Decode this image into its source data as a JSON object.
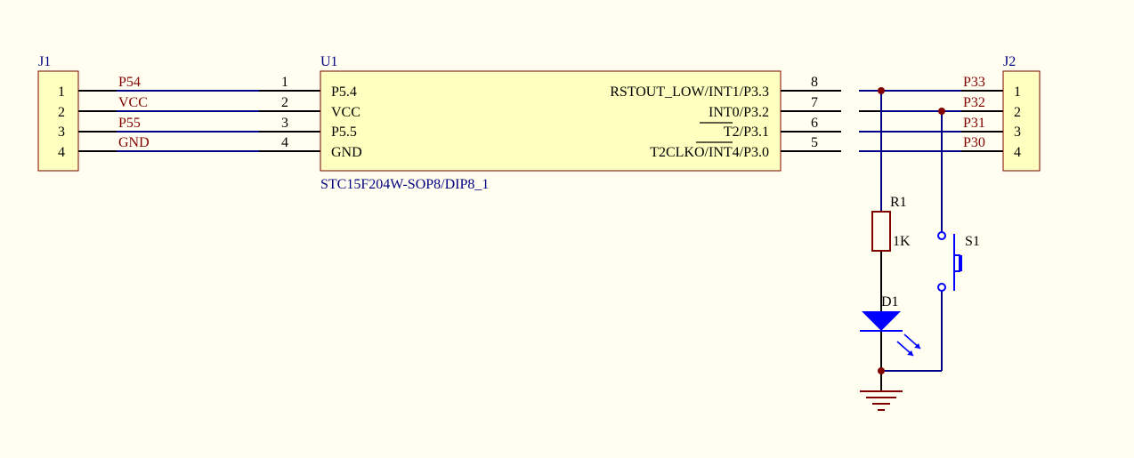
{
  "j1": {
    "designator": "J1",
    "pins": [
      "1",
      "2",
      "3",
      "4"
    ],
    "nets": [
      "P54",
      "VCC",
      "P55",
      "GND"
    ]
  },
  "u1": {
    "designator": "U1",
    "part": "STC15F204W-SOP8/DIP8_1",
    "left_pin_numbers": [
      "1",
      "2",
      "3",
      "4"
    ],
    "left_pin_names": [
      "P5.4",
      "VCC",
      "P5.5",
      "GND"
    ],
    "right_pin_numbers": [
      "8",
      "7",
      "6",
      "5"
    ],
    "right_pin_names": [
      "RSTOUT_LOW/INT1/P3.3",
      "INT0/P3.2",
      "T2/P3.1",
      "T2CLKO/INT4/P3.0"
    ]
  },
  "j2": {
    "designator": "J2",
    "pins": [
      "1",
      "2",
      "3",
      "4"
    ],
    "nets": [
      "P33",
      "P32",
      "P31",
      "P30"
    ]
  },
  "r1": {
    "designator": "R1",
    "value": "1K"
  },
  "d1": {
    "designator": "D1"
  },
  "s1": {
    "designator": "S1"
  },
  "colors": {
    "background": "#fffef0",
    "component_fill": "#ffffbf",
    "component_outline": "#800000",
    "wire": "#00008b",
    "designator_text": "#000080",
    "net_label_text": "#800000",
    "junction": "#800000",
    "part_symbol": "#0000ff"
  }
}
